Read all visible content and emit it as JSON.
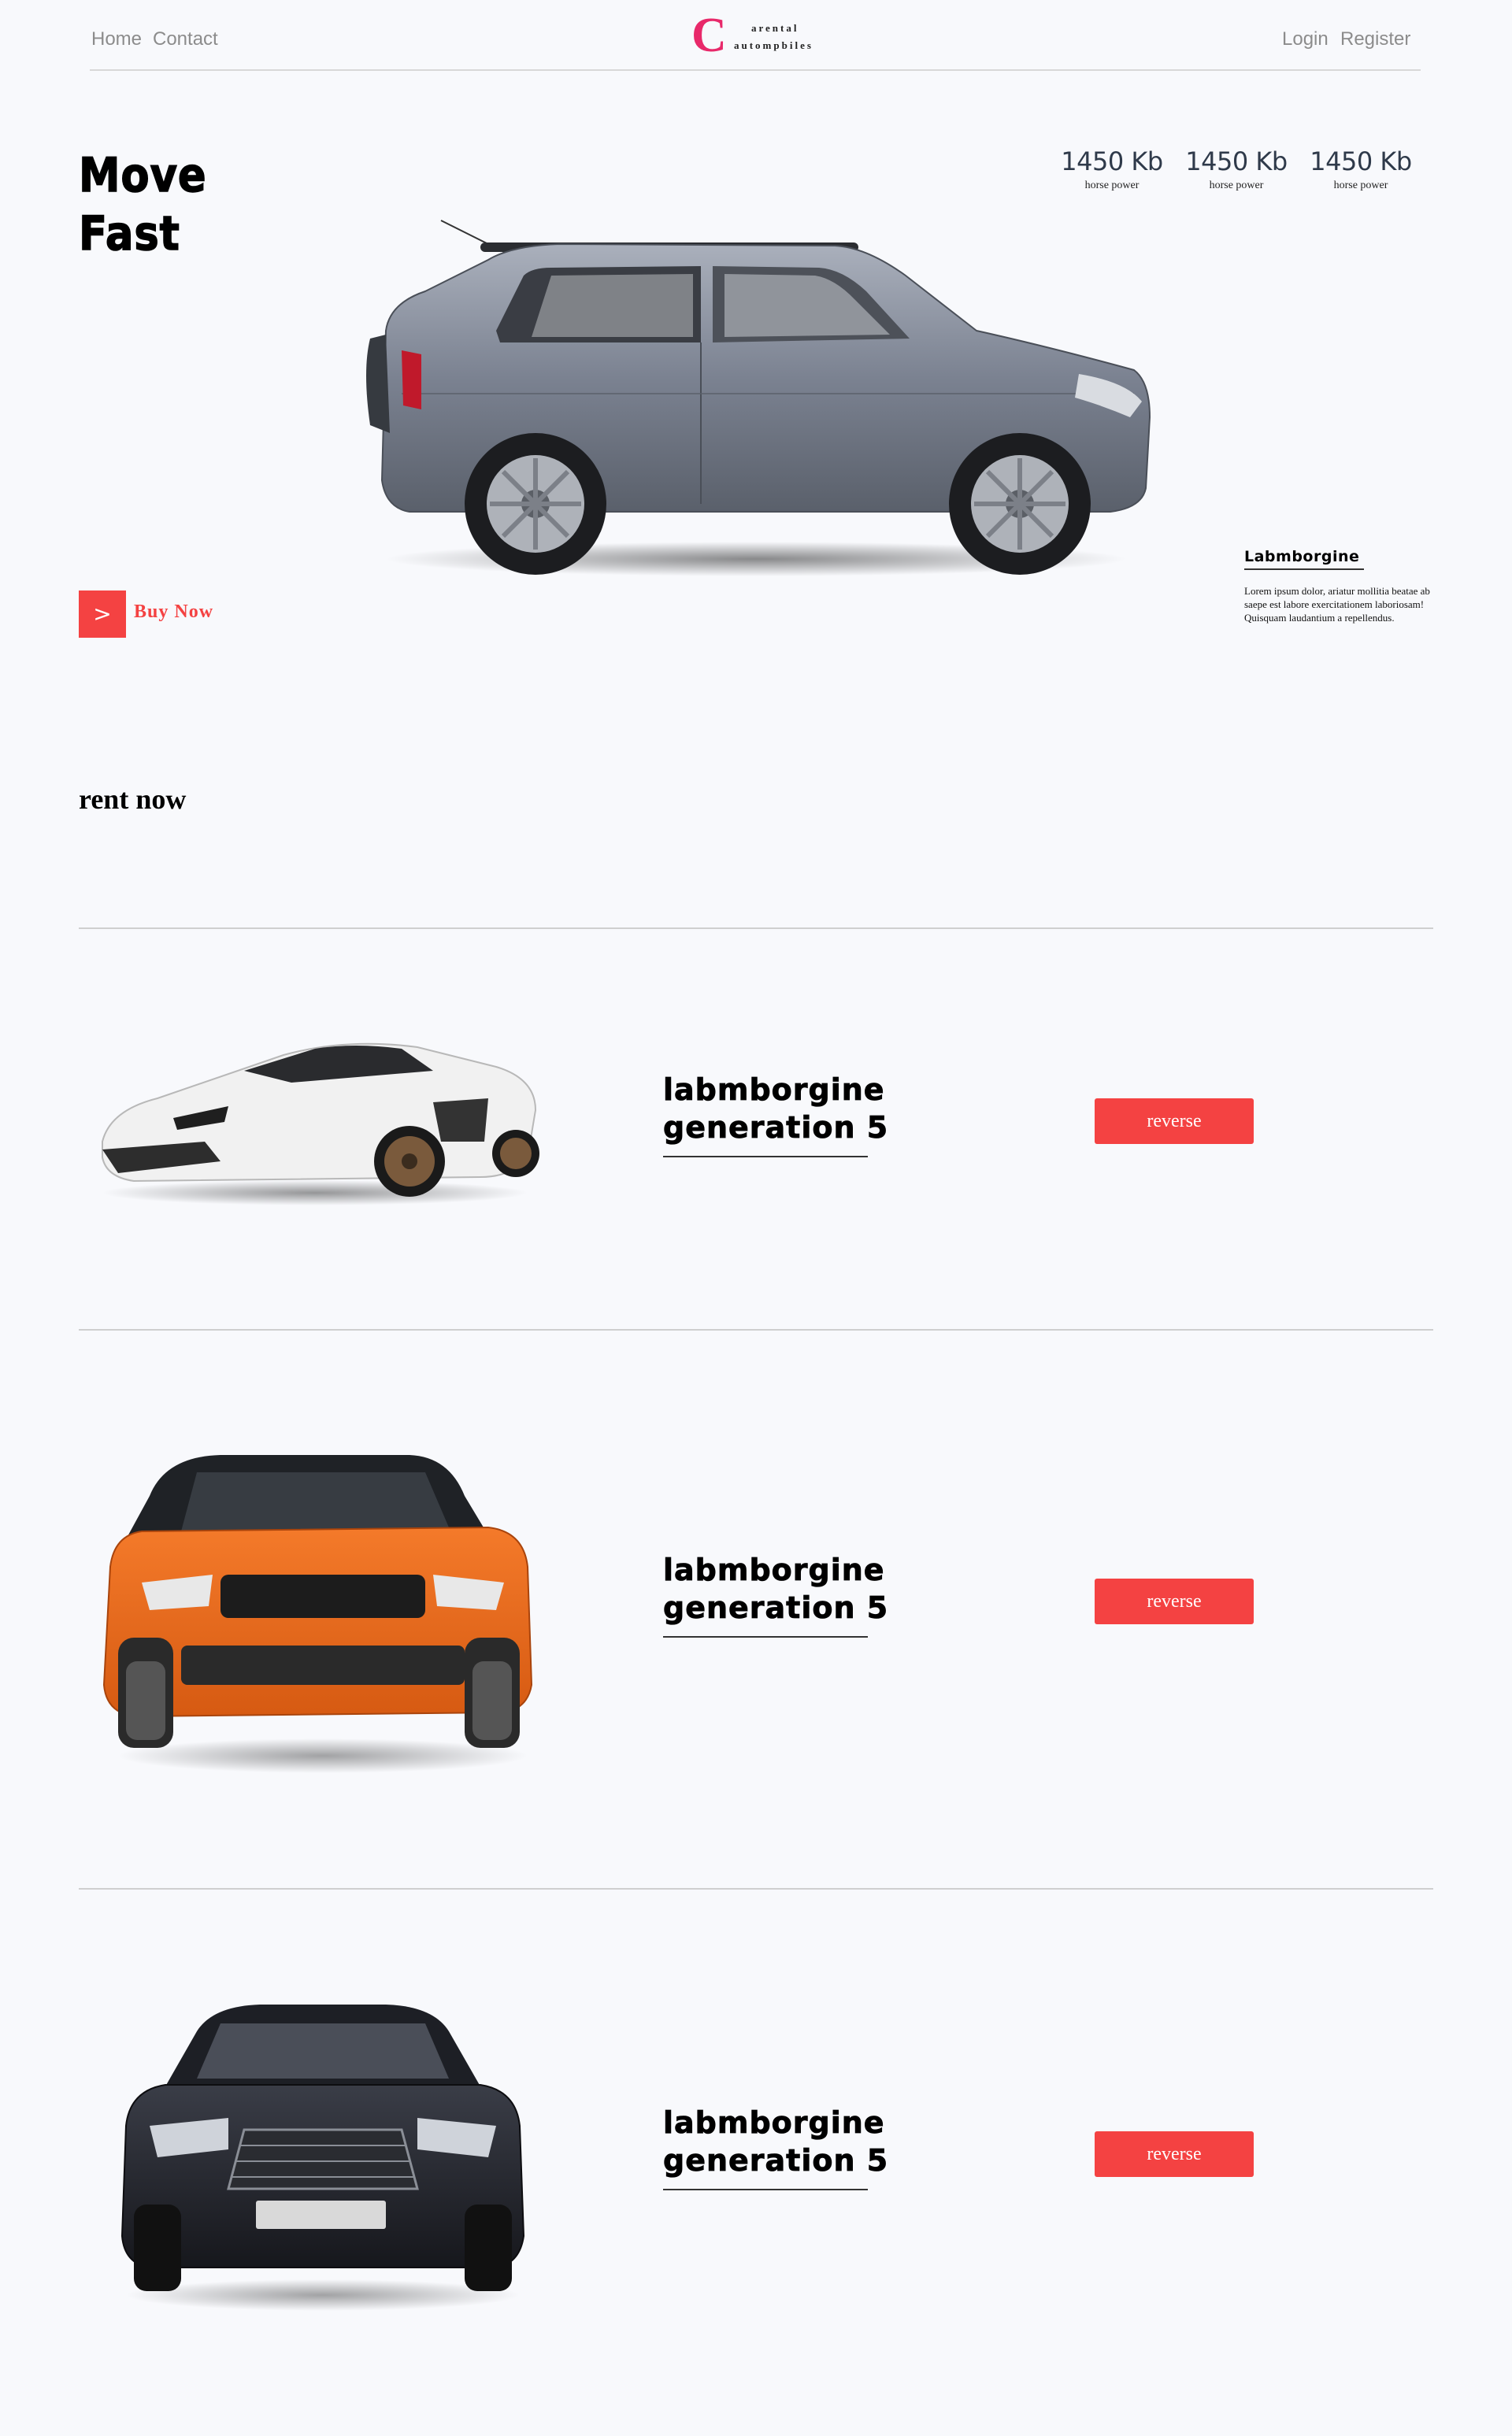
{
  "nav": {
    "home": "Home",
    "contact": "Contact",
    "login": "Login",
    "register": "Register",
    "logo_letter": "C",
    "logo_line1": "arental",
    "logo_line2": "autompbiles"
  },
  "hero": {
    "title_line1": "Move",
    "title_line2": "Fast",
    "stats": [
      {
        "value": "1450 Kb",
        "label": "horse power"
      },
      {
        "value": "1450 Kb",
        "label": "horse power"
      },
      {
        "value": "1450 Kb",
        "label": "horse power"
      }
    ],
    "buy_arrow": ">",
    "buy_label": "Buy Now",
    "side_title": "Labmborgine",
    "side_body": "Lorem ipsum dolor, ariatur mollitia beatae ab saepe est labore exercitationem laboriosam! Quisquam laudantium a repellendus."
  },
  "rent": {
    "heading": "rent now",
    "cards": [
      {
        "title_line1": "labmborgine",
        "title_line2": "generation 5",
        "button": "reverse"
      },
      {
        "title_line1": "labmborgine",
        "title_line2": "generation 5",
        "button": "reverse"
      },
      {
        "title_line1": "labmborgine",
        "title_line2": "generation 5",
        "button": "reverse"
      }
    ]
  },
  "colors": {
    "accent": "#f44242",
    "logo": "#e8296a",
    "background": "#f8f9fc"
  }
}
